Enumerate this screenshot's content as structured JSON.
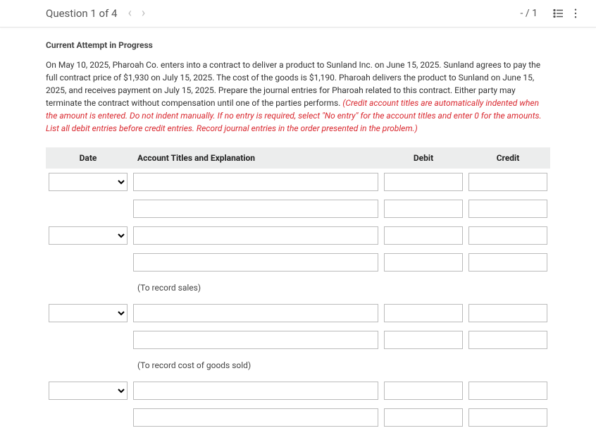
{
  "header": {
    "question_label": "Question 1 of 4",
    "attempt_counter": "- / 1"
  },
  "attempt_status": "Current Attempt in Progress",
  "problem": {
    "text_plain": "On May 10, 2025, Pharoah Co. enters into a contract to deliver a product to Sunland Inc. on June 15, 2025. Sunland agrees to pay the full contract price of $1,930 on July 15, 2025. The cost of the goods is $1,190. Pharoah delivers the product to Sunland on June 15, 2025, and receives payment on July 15, 2025. Prepare the journal entries for Pharoah related to this contract. Either party may terminate the contract without compensation until one of the parties performs. ",
    "text_red": "(Credit account titles are automatically indented when the amount is entered. Do not indent manually. If no entry is required, select \"No entry\" for the account titles and enter 0 for the amounts. List all debit entries before credit entries. Record journal entries in the order presented in the problem.)"
  },
  "table": {
    "headers": {
      "date": "Date",
      "account": "Account Titles and Explanation",
      "debit": "Debit",
      "credit": "Credit"
    },
    "notes": {
      "sales": "(To record sales)",
      "cogs": "(To record cost of goods sold)"
    }
  }
}
